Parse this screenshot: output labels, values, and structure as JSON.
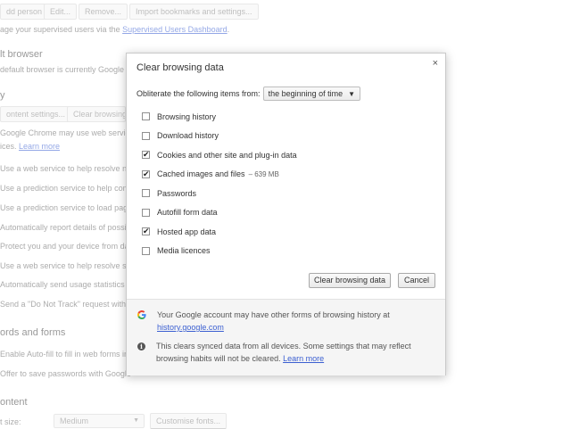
{
  "background": {
    "top_buttons": [
      "dd person",
      "Edit...",
      "Remove...",
      "Import bookmarks and settings..."
    ],
    "supervised_text": "age your supervised users via the",
    "supervised_link": "Supervised Users Dashboard",
    "supervised_suffix": ".",
    "default_browser_heading": "lt browser",
    "default_browser_text": "default browser is currently Google C",
    "privacy_heading": "y",
    "content_settings_button": "ontent settings...",
    "clear_browsing_button": "Clear browsing",
    "chrome_services_text": "Google Chrome may use web services to",
    "ices_text": "ices.",
    "learn_more": "Learn more",
    "privacy_items": [
      "Use a web service to help resolve nav",
      "Use a prediction service to help comp",
      "Use a prediction service to load page",
      "Automatically report details of possib",
      "Protect you and your device from da",
      "Use a web service to help resolve spe",
      "Automatically send usage statistics a",
      "Send a \"Do Not Track\" request with y"
    ],
    "passwords_heading": "ords and forms",
    "autofill_text": "Enable Auto-fill to fill in web forms in",
    "passwords_text": "Offer to save passwords with Google",
    "web_content_heading": "ontent",
    "font_size_label": "t size:",
    "font_size_value": "Medium",
    "customise_fonts_button": "Customise fonts..."
  },
  "dialog": {
    "title": "Clear browsing data",
    "close_glyph": "×",
    "obliterate_label": "Obliterate the following items from:",
    "time_range": "the beginning of time",
    "items": [
      {
        "label": "Browsing history",
        "checked": false,
        "extra": ""
      },
      {
        "label": "Download history",
        "checked": false,
        "extra": ""
      },
      {
        "label": "Cookies and other site and plug-in data",
        "checked": true,
        "extra": ""
      },
      {
        "label": "Cached images and files",
        "checked": true,
        "extra": "–  639 MB"
      },
      {
        "label": "Passwords",
        "checked": false,
        "extra": ""
      },
      {
        "label": "Autofill form data",
        "checked": false,
        "extra": ""
      },
      {
        "label": "Hosted app data",
        "checked": true,
        "extra": ""
      },
      {
        "label": "Media licences",
        "checked": false,
        "extra": ""
      }
    ],
    "clear_button": "Clear browsing data",
    "cancel_button": "Cancel",
    "footer": {
      "google_text": "Your Google account may have other forms of browsing history at",
      "google_link": "history.google.com",
      "sync_text": "This clears synced data from all devices. Some settings that may reflect browsing habits will not be cleared.",
      "sync_link": "Learn more"
    }
  },
  "colors": {
    "link": "#3b5fd1",
    "google_blue": "#4285F4",
    "google_red": "#EA4335",
    "google_yellow": "#FBBC05",
    "google_green": "#34A853"
  }
}
